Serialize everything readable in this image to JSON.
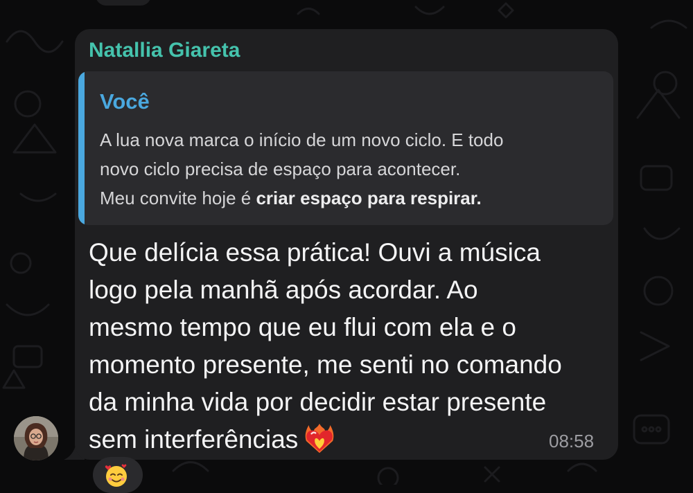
{
  "chat": {
    "sender_name": "Natallia Giareta",
    "quote": {
      "author": "Você",
      "lines": [
        "A lua nova marca o início de um novo ciclo. E todo",
        "novo ciclo precisa de espaço para acontecer."
      ],
      "last_line_prefix": "Meu convite hoje é ",
      "last_line_bold": "criar espaço para respirar."
    },
    "message": {
      "lines": [
        "Que delícia essa prática! Ouvi a música",
        "logo pela manhã após acordar. Ao",
        "mesmo tempo que eu flui com ela e o",
        "momento presente, me senti no comando",
        "da minha vida por decidir estar presente"
      ],
      "last_line": "sem interferências",
      "emoji": "heart-on-fire-icon"
    },
    "time": "08:58",
    "reaction": "smiling-face-with-hearts-icon"
  },
  "colors": {
    "background": "#0b0b0c",
    "bubble": "#1f1f21",
    "quote_bg": "#2b2b2e",
    "sender": "#45c3ad",
    "quote_accent": "#4aa8df",
    "text": "#f4f4f5",
    "timestamp": "#9d9da2"
  }
}
